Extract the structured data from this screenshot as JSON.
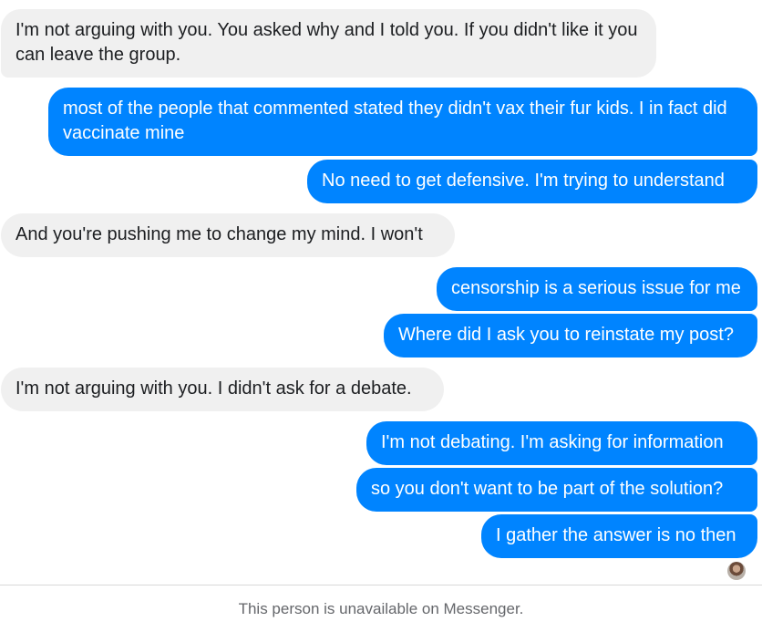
{
  "messages": [
    {
      "direction": "incoming",
      "text": "I'm not arguing with you. You asked why and I told you. If you didn't like it you can leave the group."
    },
    {
      "direction": "outgoing",
      "text": "most of the people that commented stated they didn't vax their fur kids. I in fact did vaccinate mine"
    },
    {
      "direction": "outgoing",
      "text": "No need to get defensive. I'm trying to understand"
    },
    {
      "direction": "incoming",
      "text": "And you're pushing me to change my mind. I won't"
    },
    {
      "direction": "outgoing",
      "text": "censorship is a serious issue for me"
    },
    {
      "direction": "outgoing",
      "text": "Where did I ask you to reinstate my post?"
    },
    {
      "direction": "incoming",
      "text": "I'm not arguing with you. I didn't ask for a debate."
    },
    {
      "direction": "outgoing",
      "text": "I'm not debating. I'm asking for information"
    },
    {
      "direction": "outgoing",
      "text": "so you don't want to be part of the solution?"
    },
    {
      "direction": "outgoing",
      "text": "I gather the answer is no then"
    }
  ],
  "footer": {
    "status_text": "This person is unavailable on Messenger."
  },
  "colors": {
    "outgoing_bubble": "#0084ff",
    "incoming_bubble": "#f0f0f0",
    "footer_text": "#65676b"
  }
}
